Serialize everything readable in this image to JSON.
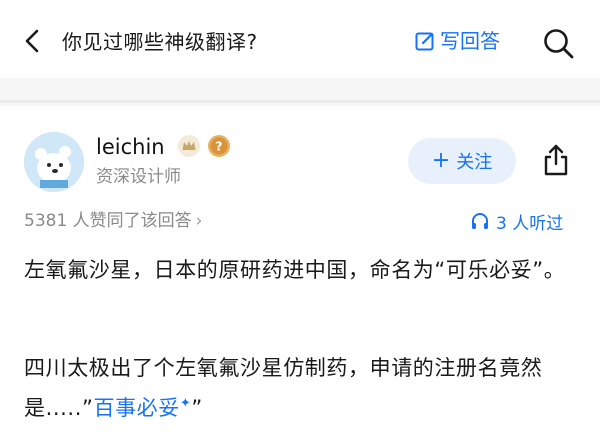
{
  "header": {
    "question_title": "你见过哪些神级翻译?",
    "write_answer_label": "写回答"
  },
  "author": {
    "name": "leichin",
    "title": "资深设计师",
    "follow_label": "关注",
    "follow_plus": "+"
  },
  "meta": {
    "vote_text": "5381 人赞同了该回答",
    "vote_chevron": "›",
    "listen_text": "3 人听过"
  },
  "content": {
    "paragraph1": "左氧氟沙星，日本的原研药进中国，命名为“可乐必妥”。",
    "paragraph2_text": "四川太极出了个左氧氟沙星仿制药，申请的注册名竟然是.....”",
    "paragraph2_link": "百事必妥",
    "paragraph2_sparkle": "✦",
    "paragraph2_end": "”"
  },
  "colors": {
    "accent": "#1772f6",
    "muted": "#8a8a8a",
    "text": "#1a1a1a",
    "follow_bg": "#e8f0fc"
  },
  "icons": [
    "back-arrow-icon",
    "edit-icon",
    "search-icon",
    "avatar-bear",
    "crown-badge-icon",
    "question-badge-icon",
    "share-icon",
    "headphone-icon"
  ]
}
